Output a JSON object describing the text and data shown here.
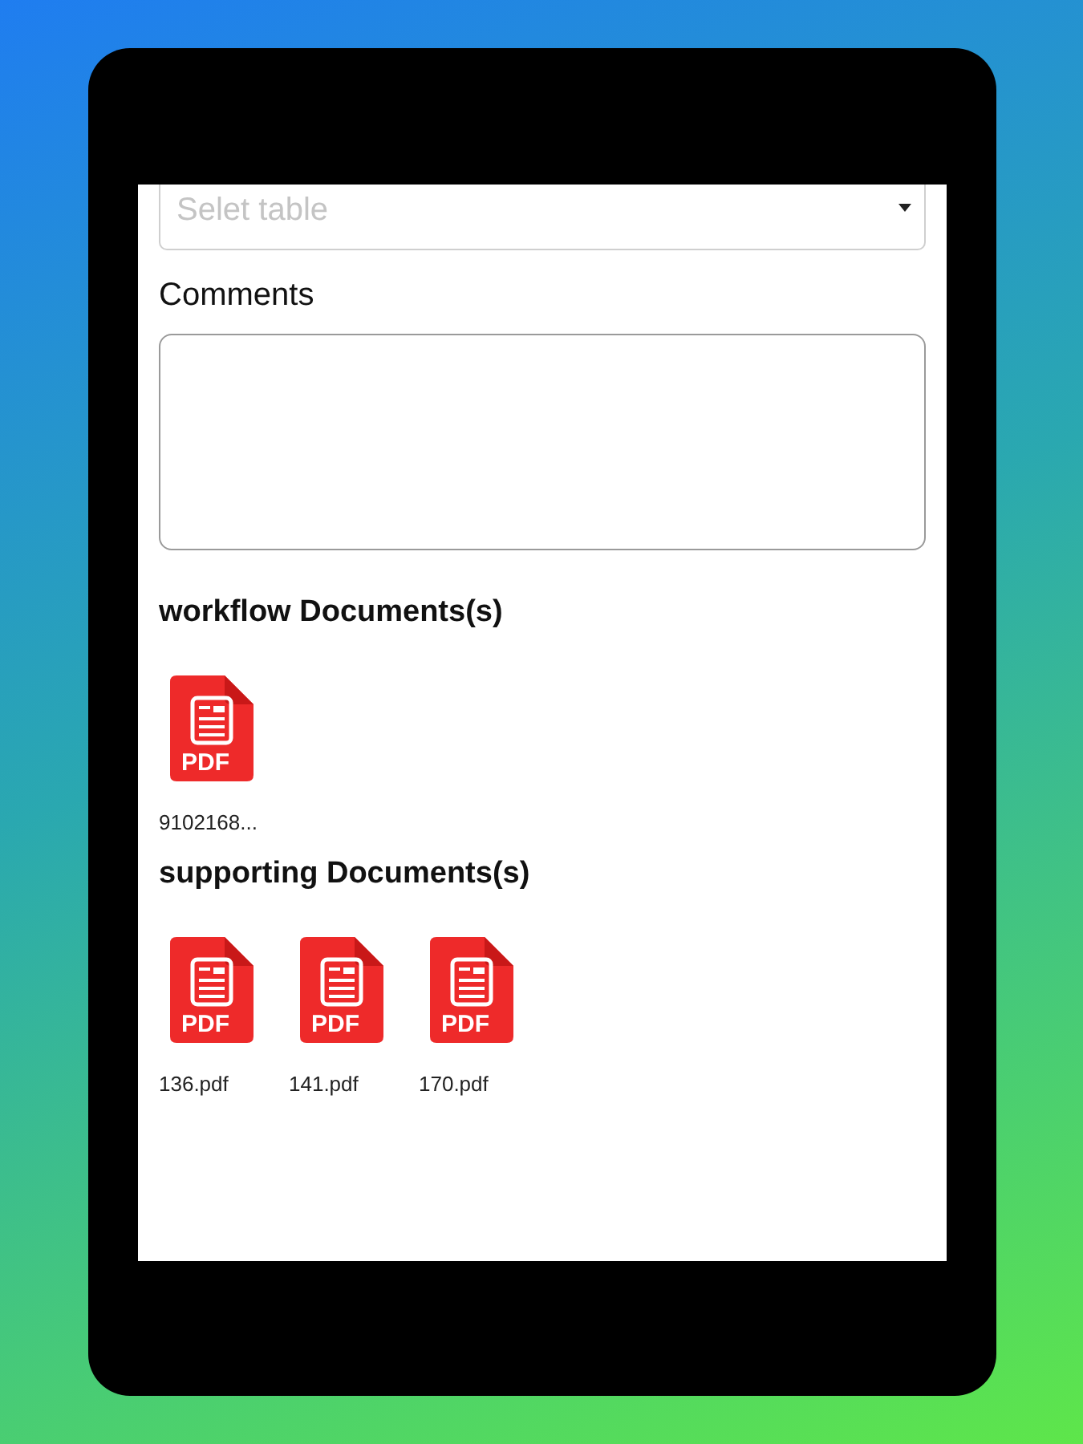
{
  "table_select": {
    "placeholder": "Selet table"
  },
  "comments": {
    "label": "Comments"
  },
  "sections": [
    {
      "title": "workflow Documents(s)",
      "documents": [
        {
          "type_label": "PDF",
          "name": "9102168..."
        }
      ]
    },
    {
      "title": "supporting Documents(s)",
      "documents": [
        {
          "type_label": "PDF",
          "name": "136.pdf"
        },
        {
          "type_label": "PDF",
          "name": "141.pdf"
        },
        {
          "type_label": "PDF",
          "name": "170.pdf"
        }
      ]
    }
  ]
}
